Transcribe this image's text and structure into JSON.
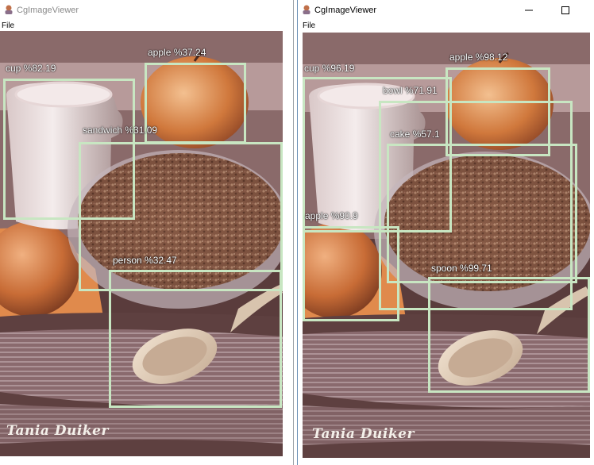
{
  "windows": [
    {
      "title": "CgImageViewer",
      "menu": {
        "file_label": "File"
      },
      "photo": {
        "signature": "Tania Duiker"
      },
      "detections": [
        {
          "label": "cup %82.19"
        },
        {
          "label": "apple %37.24"
        },
        {
          "label": "sandwich %31.09"
        },
        {
          "label": "person %32.47"
        }
      ]
    },
    {
      "title": "CgImageViewer",
      "menu": {
        "file_label": "File"
      },
      "caption_buttons": {
        "minimize_icon": "minimize-icon",
        "maximize_icon": "maximize-icon"
      },
      "photo": {
        "signature": "Tania Duiker"
      },
      "detections": [
        {
          "label": "cup %96.19"
        },
        {
          "label": "apple %98.12"
        },
        {
          "label": "bowl %71.91"
        },
        {
          "label": "cake %57.1"
        },
        {
          "label": "apple %90.9"
        },
        {
          "label": "spoon %99.71"
        }
      ]
    }
  ],
  "colors": {
    "box": "#c8e6c2",
    "label_text": "#ffffff",
    "photo_background": "#5a3c3c"
  }
}
